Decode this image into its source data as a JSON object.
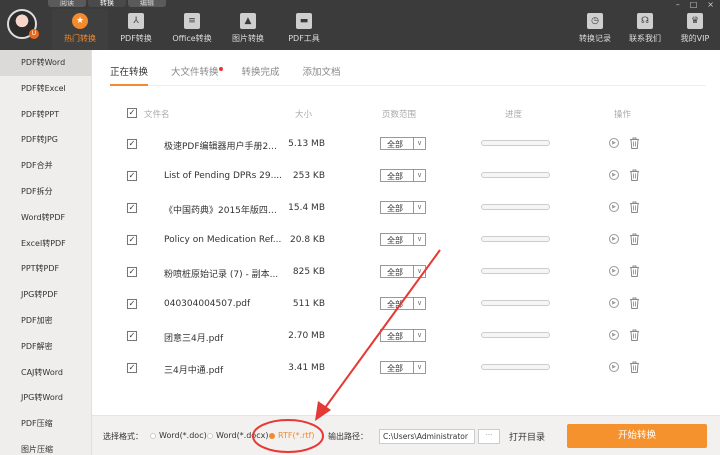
{
  "top_tabs": [
    "阅读",
    "转换",
    "编辑"
  ],
  "window_controls": [
    "–",
    "□",
    "×"
  ],
  "nav": [
    {
      "label": "热门转换",
      "icon": "star-icon",
      "active": true
    },
    {
      "label": "PDF转换",
      "icon": "pdf-icon"
    },
    {
      "label": "Office转换",
      "icon": "office-icon"
    },
    {
      "label": "图片转换",
      "icon": "image-icon"
    },
    {
      "label": "PDF工具",
      "icon": "toolbox-icon"
    }
  ],
  "right_nav": [
    {
      "label": "转换记录",
      "icon": "history-icon"
    },
    {
      "label": "联系我们",
      "icon": "headset-icon"
    },
    {
      "label": "我的VIP",
      "icon": "crown-icon"
    }
  ],
  "sidebar": [
    "PDF转Word",
    "PDF转Excel",
    "PDF转PPT",
    "PDF转JPG",
    "PDF合并",
    "PDF拆分",
    "Word转PDF",
    "Excel转PDF",
    "PPT转PDF",
    "JPG转PDF",
    "PDF加密",
    "PDF解密",
    "CAJ转Word",
    "JPG转Word",
    "PDF压缩",
    "图片压缩"
  ],
  "sub_tabs": [
    "正在转换",
    "大文件转换",
    "转换完成",
    "添加文档"
  ],
  "columns": {
    "name": "文件名",
    "size": "大小",
    "pages": "页数范围",
    "progress": "进度",
    "action": "操作"
  },
  "files": [
    {
      "name": "极速PDF编辑器用户手册2...",
      "size": "5.13 MB",
      "pages": "全部",
      "progress": 0
    },
    {
      "name": "List of Pending DPRs 29....",
      "size": "253 KB",
      "pages": "全部",
      "progress": 0
    },
    {
      "name": "《中国药典》2015年版四部...",
      "size": "15.4 MB",
      "pages": "全部",
      "progress": 0
    },
    {
      "name": "Policy on Medication Ref...",
      "size": "20.8 KB",
      "pages": "全部",
      "progress": 0
    },
    {
      "name": "粉喷桩原始记录 (7) - 副本...",
      "size": "825 KB",
      "pages": "全部",
      "progress": 0
    },
    {
      "name": "040304004507.pdf",
      "size": "511 KB",
      "pages": "全部",
      "progress": 0
    },
    {
      "name": "团意三4月.pdf",
      "size": "2.70 MB",
      "pages": "全部",
      "progress": 0
    },
    {
      "name": "三4月中通.pdf",
      "size": "3.41 MB",
      "pages": "全部",
      "progress": 0
    }
  ],
  "footer": {
    "format_label": "选择格式：",
    "formats": [
      {
        "label": "Word(*.doc)",
        "selected": false
      },
      {
        "label": "Word(*.docx)",
        "selected": false
      },
      {
        "label": "RTF(*.rtf)",
        "selected": true
      }
    ],
    "path_label": "输出路径：",
    "path_value": "C:\\Users\\Administrator",
    "browse": "···",
    "open_dir": "打开目录",
    "start": "开始转换"
  },
  "colors": {
    "accent": "#f28a2f",
    "annotation": "#e53935",
    "topbar": "#3b3b3b"
  }
}
